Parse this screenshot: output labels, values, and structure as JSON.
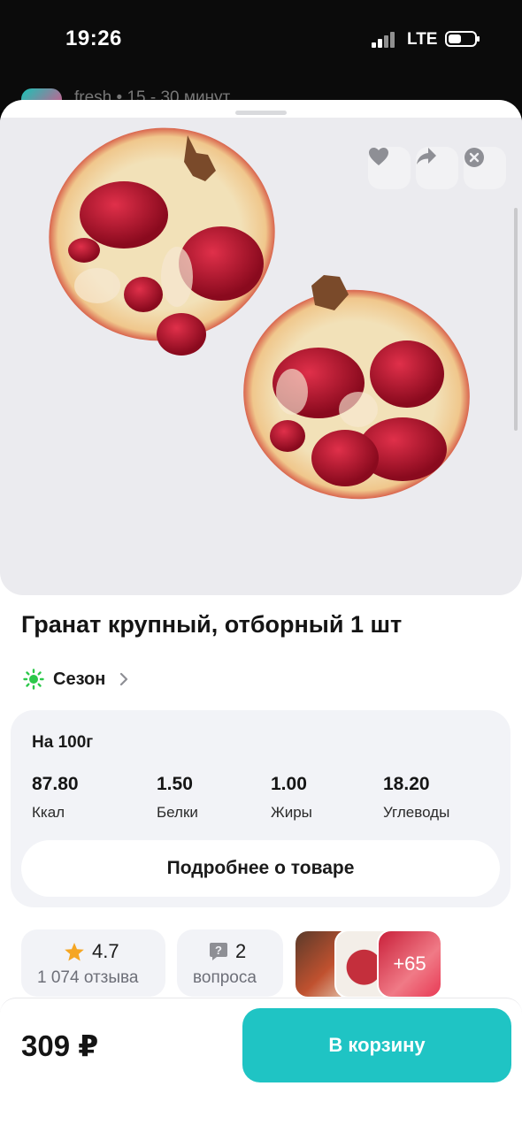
{
  "status_bar": {
    "time": "19:26",
    "network": "LTE"
  },
  "background_app": {
    "text": "fresh • 15 - 30 минут"
  },
  "product": {
    "title": "Гранат крупный, отборный 1 шт",
    "season_label": "Сезон",
    "image_icons": [
      "heart-icon",
      "share-icon",
      "close-icon"
    ]
  },
  "nutrition": {
    "header": "На 100г",
    "items": [
      {
        "value": "87.80",
        "label": "Ккал"
      },
      {
        "value": "1.50",
        "label": "Белки"
      },
      {
        "value": "1.00",
        "label": "Жиры"
      },
      {
        "value": "18.20",
        "label": "Углеводы"
      }
    ],
    "details_button": "Подробнее о товаре"
  },
  "rating": {
    "value": "4.7",
    "reviews": "1 074 отзыва"
  },
  "questions": {
    "count": "2",
    "label": "вопроса"
  },
  "photos": {
    "more": "+65"
  },
  "footer": {
    "price": "309 ₽",
    "cart_button": "В корзину"
  },
  "colors": {
    "accent": "#1fc4c4",
    "season_icon": "#2cc84a",
    "star": "#f5a623"
  }
}
